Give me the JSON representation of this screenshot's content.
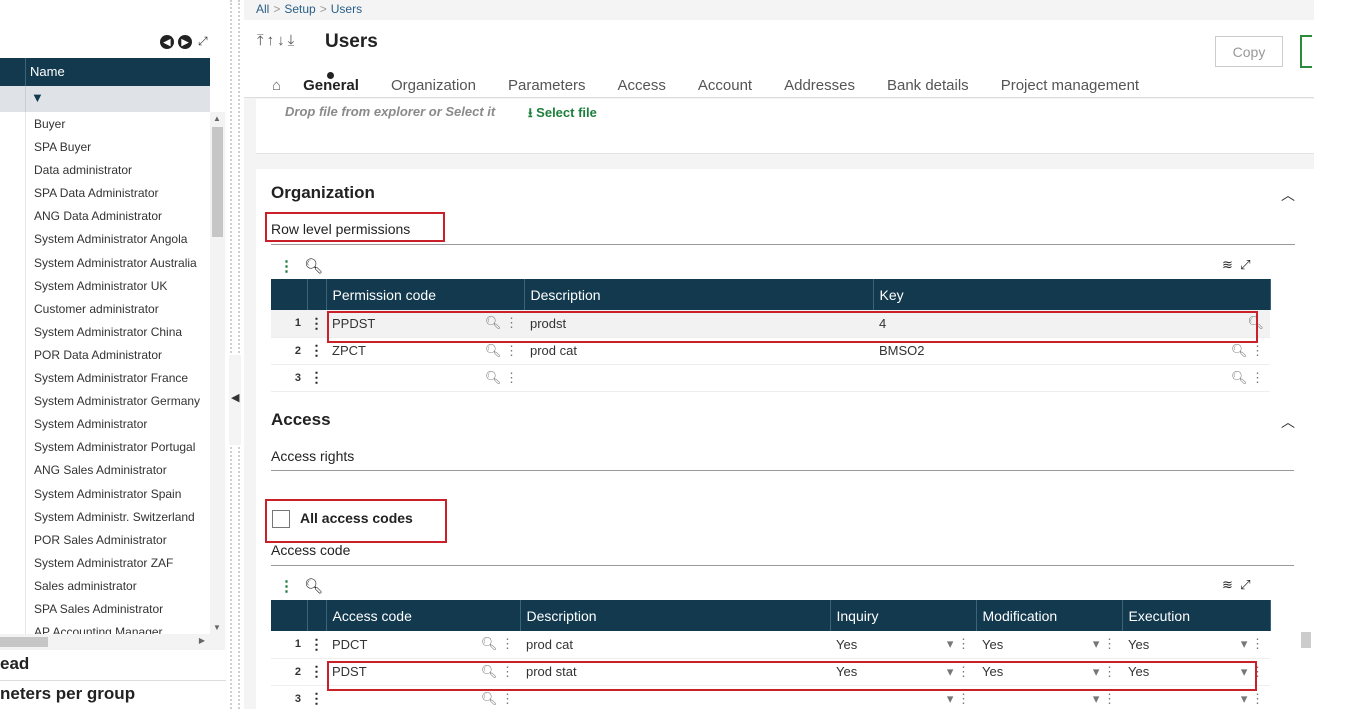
{
  "left_panel": {
    "column_header": "Name",
    "rows": [
      "Buyer",
      "SPA Buyer",
      "Data administrator",
      "SPA Data Administrator",
      "ANG Data Administrator",
      "System Administrator Angola",
      "System Administrator Australia",
      "System Administrator UK",
      "Customer administrator",
      "System Administrator China",
      "POR Data Administrator",
      "System Administrator France",
      "System Administrator Germany",
      "System Administrator",
      "System Administrator Portugal",
      "ANG Sales Administrator",
      "System Administrator Spain",
      "System Administr. Switzerland",
      "POR Sales Administrator",
      "System Administrator ZAF",
      "Sales administrator",
      "SPA Sales Administrator",
      "AP Accounting Manager"
    ],
    "section1": "ead",
    "section2": "neters per group"
  },
  "breadcrumb": [
    "All",
    "Setup",
    "Users"
  ],
  "header": {
    "title": "Users",
    "copy_label": "Copy",
    "tabs": [
      "General",
      "Organization",
      "Parameters",
      "Access",
      "Account",
      "Addresses",
      "Bank details",
      "Project management"
    ],
    "active_tab": "General"
  },
  "dropzone": {
    "text": "Drop file from explorer or Select it",
    "select_label": "Select file"
  },
  "organization": {
    "title": "Organization",
    "subhead": "Row level permissions",
    "columns": [
      "Permission code",
      "Description",
      "Key"
    ],
    "rows": [
      {
        "n": "1",
        "code": "PPDST",
        "desc": "prodst",
        "key": "4"
      },
      {
        "n": "2",
        "code": "ZPCT",
        "desc": "prod cat",
        "key": "BMSO2"
      },
      {
        "n": "3",
        "code": "",
        "desc": "",
        "key": ""
      }
    ]
  },
  "access": {
    "title": "Access",
    "subhead": "Access rights",
    "all_codes_label": "All access codes",
    "all_codes_checked": false,
    "access_code_label": "Access code",
    "columns": [
      "Access code",
      "Description",
      "Inquiry",
      "Modification",
      "Execution"
    ],
    "rows": [
      {
        "n": "1",
        "code": "PDCT",
        "desc": "prod cat",
        "inq": "Yes",
        "mod": "Yes",
        "exe": "Yes"
      },
      {
        "n": "2",
        "code": "PDST",
        "desc": "prod stat",
        "inq": "Yes",
        "mod": "Yes",
        "exe": "Yes"
      },
      {
        "n": "3",
        "code": "",
        "desc": "",
        "inq": "",
        "mod": "",
        "exe": ""
      }
    ]
  },
  "colors": {
    "header_bg": "#12394e",
    "accent_green": "#1e7f3c",
    "highlight_red": "#c9202a"
  }
}
